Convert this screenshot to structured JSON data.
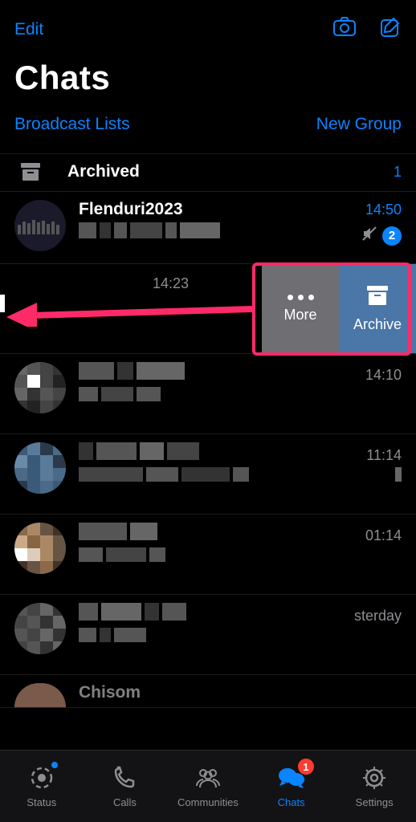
{
  "topbar": {
    "edit": "Edit"
  },
  "title": "Chats",
  "subbar": {
    "broadcast": "Broadcast Lists",
    "newgroup": "New Group"
  },
  "archived": {
    "label": "Archived",
    "count": "1"
  },
  "chats": [
    {
      "name": "Flenduri2023",
      "time": "14:50",
      "unread": true,
      "badge": "2",
      "muted": true
    },
    {
      "name": "",
      "time": "14:23",
      "swiped": true
    },
    {
      "name": "",
      "time": "14:10"
    },
    {
      "name": "",
      "time": "11:14"
    },
    {
      "name": "",
      "time": "01:14"
    },
    {
      "name": "",
      "time": "sterday"
    },
    {
      "name": "Chisom",
      "time": ""
    }
  ],
  "swipe_actions": {
    "more": "More",
    "archive": "Archive"
  },
  "tabs": {
    "status": "Status",
    "calls": "Calls",
    "communities": "Communities",
    "chats": "Chats",
    "settings": "Settings",
    "chats_badge": "1"
  },
  "colors": {
    "accent": "#0a84ff",
    "highlight": "#ff2a68",
    "action_more": "#6e6e73",
    "action_archive": "#4a76a8",
    "badge_red": "#ff3b30"
  }
}
